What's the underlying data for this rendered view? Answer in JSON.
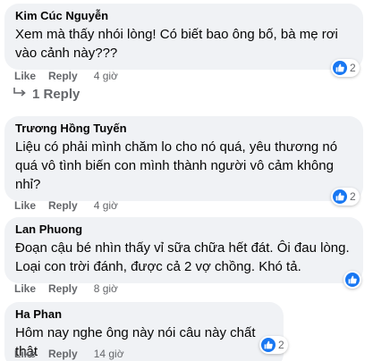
{
  "comments": [
    {
      "author": "Kim Cúc Nguyễn",
      "text": "Xem mà thấy nhói lòng! Có biết bao ông bố, bà mẹ rơi vào cảnh này???",
      "like_label": "Like",
      "reply_label": "Reply",
      "time": "4 giờ",
      "reaction_icon": "like-thumb-icon",
      "reaction_count": "2"
    },
    {
      "author": "Trương Hồng Tuyến",
      "text": "Liệu có phải mình chăm lo cho nó quá, yêu thương nó quá vô tình biến con mình thành người vô cảm không nhỉ?",
      "like_label": "Like",
      "reply_label": "Reply",
      "time": "4 giờ",
      "reaction_icon": "like-thumb-icon",
      "reaction_count": "2"
    },
    {
      "author": "Lan Phuong",
      "text": "Đoạn cậu bé nhìn thấy vỉ sữa chữa hết đát. Ôi đau lòng. Loại con trời đánh, được cả 2 vợ chồng. Khó tả.",
      "like_label": "Like",
      "reply_label": "Reply",
      "time": "8 giờ",
      "reaction_icon": "like-thumb-icon",
      "reaction_count": ""
    },
    {
      "author": "Ha Phan",
      "text": "Hôm nay nghe ông này nói câu này chất thật",
      "like_label": "Like",
      "reply_label": "Reply",
      "time": "14 giờ",
      "reaction_icon": "like-thumb-icon",
      "reaction_count": "2"
    }
  ],
  "view_replies": {
    "label": "1 Reply",
    "icon": "reply-arrow-icon"
  },
  "colors": {
    "bubble_bg": "#f0f2f5",
    "meta_text": "#65676b",
    "like_blue": "#1877f2"
  }
}
